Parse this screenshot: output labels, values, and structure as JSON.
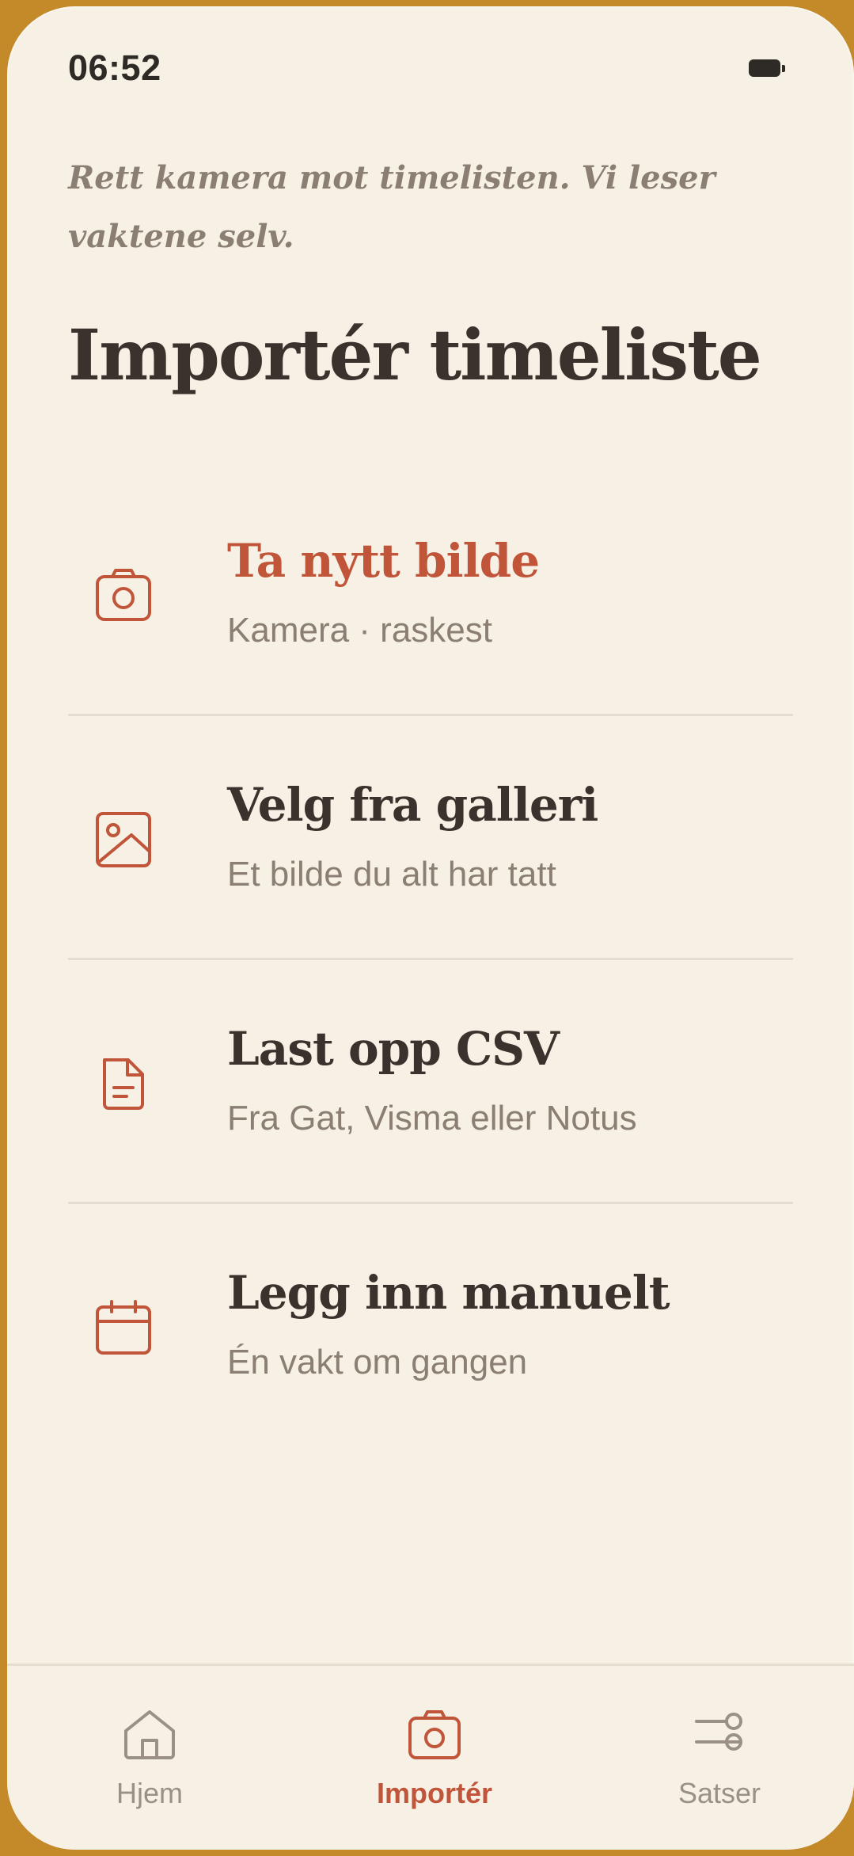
{
  "status_bar": {
    "time": "06:52",
    "battery_icon": "battery-icon"
  },
  "header": {
    "subtitle": "Rett kamera mot timelisten. Vi leser vaktene selv.",
    "title": "Importér timeliste"
  },
  "options": [
    {
      "icon": "camera-icon",
      "title": "Ta nytt bilde",
      "desc": "Kamera · raskest",
      "highlighted": true
    },
    {
      "icon": "image-icon",
      "title": "Velg fra galleri",
      "desc": "Et bilde du alt har tatt",
      "highlighted": false
    },
    {
      "icon": "document-icon",
      "title": "Last opp CSV",
      "desc": "Fra Gat, Visma eller Notus",
      "highlighted": false
    },
    {
      "icon": "calendar-icon",
      "title": "Legg inn manuelt",
      "desc": "Én vakt om gangen",
      "highlighted": false
    }
  ],
  "tabbar": {
    "tabs": [
      {
        "icon": "home-icon",
        "label": "Hjem",
        "active": false
      },
      {
        "icon": "camera-icon",
        "label": "Importér",
        "active": true
      },
      {
        "icon": "sliders-icon",
        "label": "Satser",
        "active": false
      }
    ]
  },
  "colors": {
    "accent": "#c0553a",
    "background": "#f6f0e5",
    "text": "#3a332d",
    "muted": "#8a7f72",
    "frame": "#c48a2a"
  }
}
